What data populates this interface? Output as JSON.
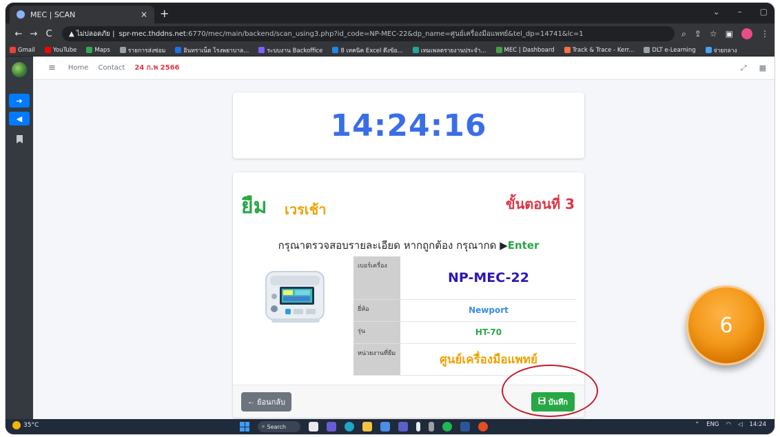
{
  "browser": {
    "tab_title": "MEC | SCAN",
    "tab_close": "×",
    "new_tab": "+",
    "window_controls": [
      "⌄",
      "–",
      "▢"
    ],
    "security_label": "▲ ไม่ปลอดภัย |",
    "url_host": "spr-mec.thddns.net",
    "url_rest": ":6770/mec/main/backend/scan_using3.php?id_code=NP-MEC-22&dp_name=ศูนย์เครื่องมือแพทย์&tel_dp=14741&lc=1",
    "bookmarks": [
      {
        "label": "Gmail",
        "color": "#ea4335"
      },
      {
        "label": "YouTube",
        "color": "#ff0000"
      },
      {
        "label": "Maps",
        "color": "#34a853"
      },
      {
        "label": "รายการส่งซ่อม",
        "color": "#9aa0a6"
      },
      {
        "label": "อินทราเน็ต โรงพยาบาล...",
        "color": "#1a73e8"
      },
      {
        "label": "ระบบงาน Backoffice",
        "color": "#7b61ff"
      },
      {
        "label": "8 เทคนิค Excel ดึงข้อ...",
        "color": "#1e88e5"
      },
      {
        "label": "เทมเพลตรายงานประจำ...",
        "color": "#26a69a"
      },
      {
        "label": "MEC | Dashboard",
        "color": "#43a047"
      },
      {
        "label": "Track & Trace - Kerr...",
        "color": "#ff7043"
      },
      {
        "label": "DLT e-Learning",
        "color": "#9aa0a6"
      },
      {
        "label": "จ่ายกลาง",
        "color": "#42a5f5"
      }
    ]
  },
  "topnav": {
    "home": "Home",
    "contact": "Contact",
    "date": "24 ก.พ 2566"
  },
  "clock": "14:24:16",
  "card": {
    "title_borrow": "ยืม",
    "title_shift": "เวรเช้า",
    "step": "ขั้นตอนที่ 3",
    "instruction": "กรุณาตรวจสอบรายละเอียด หากถูกต้อง กรุณากด",
    "instruction_key": "Enter",
    "rows": [
      {
        "label": "เบอร์เครื่อง",
        "value": "NP-MEC-22"
      },
      {
        "label": "ยี่ห้อ",
        "value": "Newport"
      },
      {
        "label": "รุ่น",
        "value": "HT-70"
      },
      {
        "label": "หน่วยงานที่ยืม",
        "value": "ศูนย์เครื่องมือแพทย์"
      }
    ],
    "back_label": "ย้อนกลับ",
    "save_label": "บันทึก"
  },
  "callout_number": "6",
  "taskbar": {
    "temperature": "35°C",
    "search": "Search",
    "lang": "ENG",
    "time": "14:24"
  }
}
